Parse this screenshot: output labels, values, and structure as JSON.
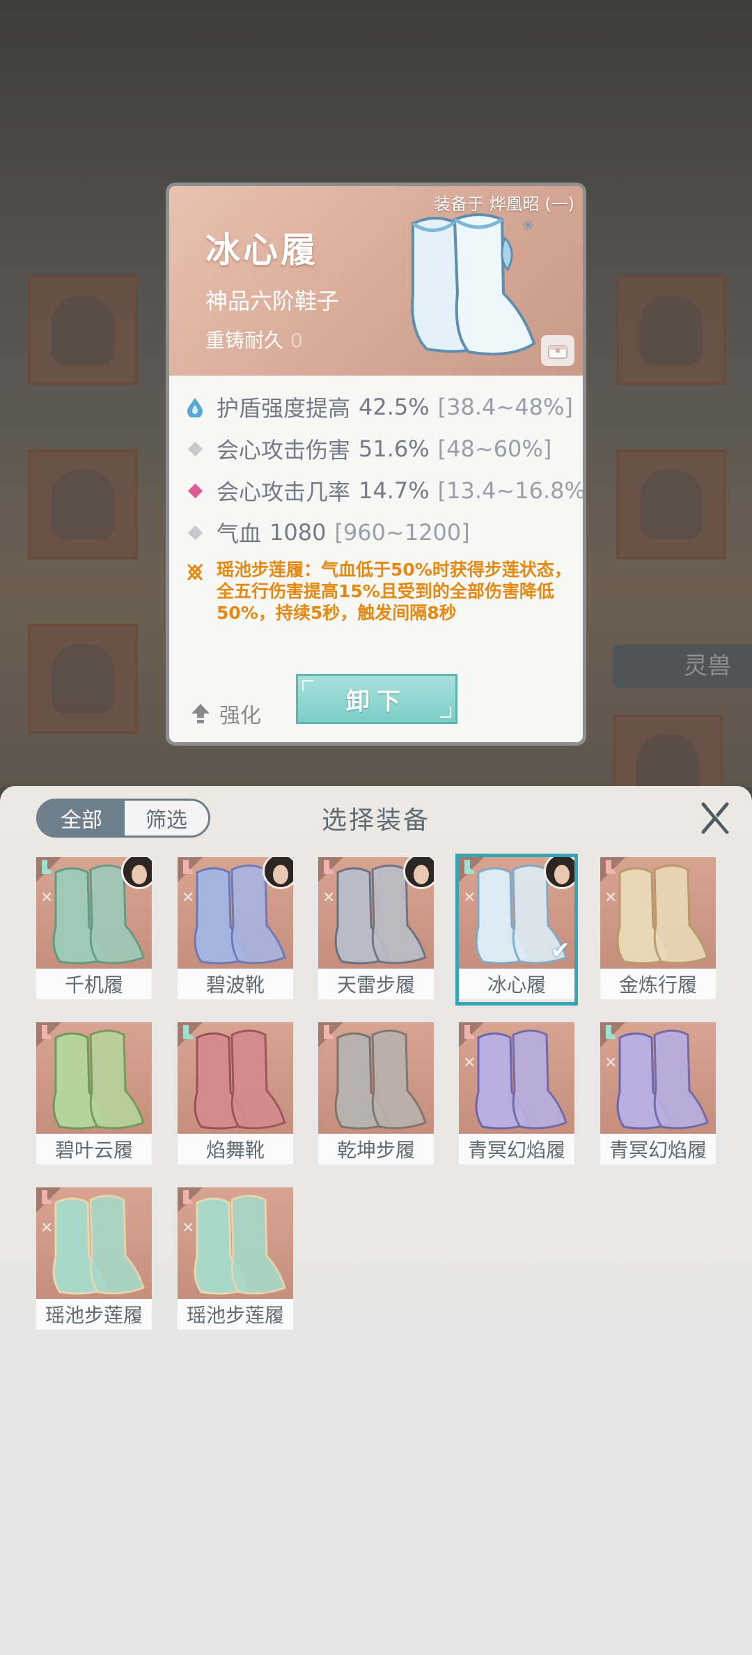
{
  "background": {
    "side_button": "灵兽"
  },
  "card": {
    "equipped_on": "装备于 烨凰昭 (一)",
    "name": "冰心履",
    "type": "神品六阶鞋子",
    "reforge_label": "重铸耐久",
    "reforge_value": "0",
    "stats": [
      {
        "icon": "shield-drop-icon",
        "name": "护盾强度提高",
        "value": "42.5%",
        "range": "[38.4~48%]"
      },
      {
        "icon": "diamond-gray-icon",
        "name": "会心攻击伤害",
        "value": "51.6%",
        "range": "[48~60%]"
      },
      {
        "icon": "diamond-pink-icon",
        "name": "会心攻击几率",
        "value": "14.7%",
        "range": "[13.4~16.8%]"
      },
      {
        "icon": "diamond-gray-icon",
        "name": "气血",
        "value": "1080",
        "range": "[960~1200]"
      }
    ],
    "effect": "瑶池步莲履：气血低于50%时获得步莲状态，全五行伤害提高15%且受到的全部伤害降低50%，持续5秒，触发间隔8秒",
    "enhance_label": "强化",
    "unequip_label": "卸下"
  },
  "sheet": {
    "tab_all": "全部",
    "tab_filter": "筛选",
    "title": "选择装备",
    "items": [
      {
        "name": "千机履",
        "has_avatar": true,
        "selected": false
      },
      {
        "name": "碧波靴",
        "has_avatar": true,
        "selected": false
      },
      {
        "name": "天雷步履",
        "has_avatar": true,
        "selected": false
      },
      {
        "name": "冰心履",
        "has_avatar": true,
        "selected": true
      },
      {
        "name": "金炼行履",
        "has_avatar": false,
        "selected": false
      },
      {
        "name": "碧叶云履",
        "has_avatar": false,
        "selected": false
      },
      {
        "name": "焰舞靴",
        "has_avatar": false,
        "selected": false
      },
      {
        "name": "乾坤步履",
        "has_avatar": false,
        "selected": false
      },
      {
        "name": "青冥幻焰履",
        "has_avatar": false,
        "selected": false
      },
      {
        "name": "青冥幻焰履",
        "has_avatar": false,
        "selected": false
      },
      {
        "name": "瑶池步莲履",
        "has_avatar": false,
        "selected": false
      },
      {
        "name": "瑶池步莲履",
        "has_avatar": false,
        "selected": false
      }
    ]
  },
  "colors": {
    "accent_teal": "#37a5b6",
    "effect_orange": "#e48a12",
    "stat_text": "#757a84"
  }
}
